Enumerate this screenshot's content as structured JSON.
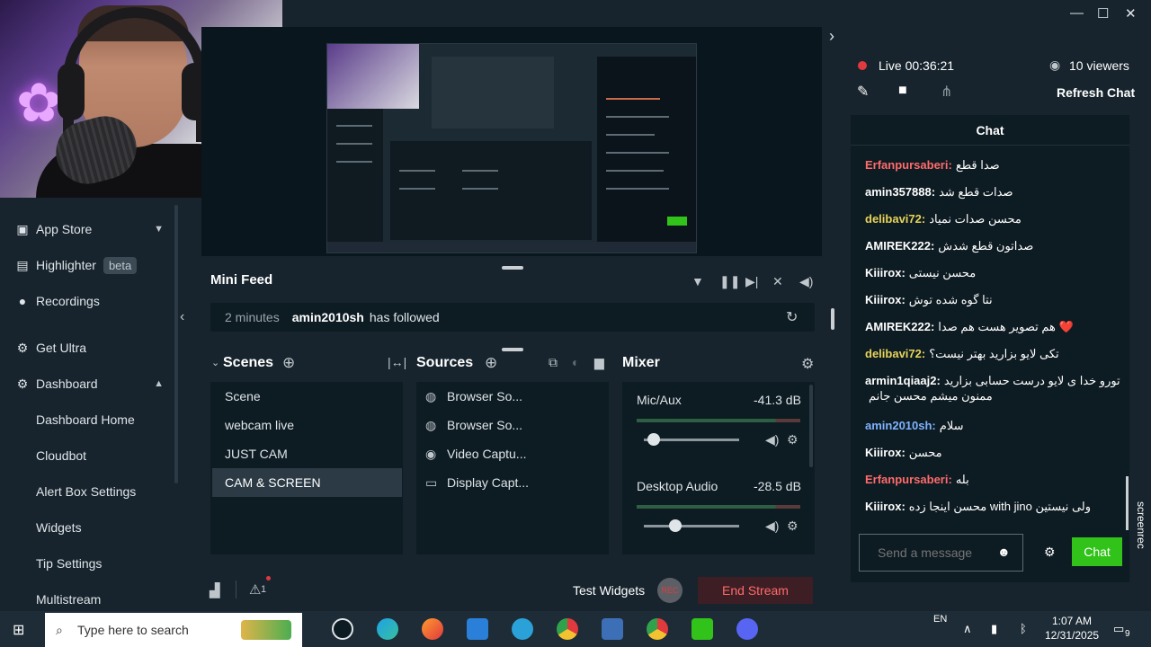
{
  "colors": {
    "live": "#e0393e",
    "chat_send": "#31c31a",
    "end_stream_bg": "#3d1e24",
    "end_stream_text": "#ff6b6b",
    "bg": "#17242d",
    "panel": "#0d1b22"
  },
  "window_controls": {
    "minimize": "—",
    "maximize": "☐",
    "close": "✕"
  },
  "sidebar": {
    "items": [
      {
        "label": "App Store",
        "icon": "app-store-icon"
      },
      {
        "label": "Highlighter",
        "badge": "beta",
        "icon": "highlighter-icon"
      },
      {
        "label": "Recordings",
        "icon": "recordings-icon"
      },
      {
        "label": "Get Ultra",
        "icon": "ultra-icon"
      },
      {
        "label": "Dashboard",
        "icon": "dashboard-icon"
      },
      {
        "label": "Dashboard Home"
      },
      {
        "label": "Cloudbot"
      },
      {
        "label": "Alert Box Settings"
      },
      {
        "label": "Widgets"
      },
      {
        "label": "Tip Settings"
      },
      {
        "label": "Multistream"
      }
    ]
  },
  "mini_feed": {
    "title": "Mini Feed",
    "event": {
      "time": "2 minutes",
      "user": "amin2010sh",
      "action": "has followed"
    }
  },
  "scenes": {
    "title": "Scenes",
    "items": [
      "Scene",
      "webcam live",
      "JUST CAM",
      "CAM & SCREEN"
    ],
    "active": "CAM & SCREEN"
  },
  "sources": {
    "title": "Sources",
    "items": [
      {
        "label": "Browser So...",
        "icon": "globe-icon"
      },
      {
        "label": "Browser So...",
        "icon": "globe-icon"
      },
      {
        "label": "Video Captu...",
        "icon": "camera-icon"
      },
      {
        "label": "Display Capt...",
        "icon": "monitor-icon"
      }
    ]
  },
  "mixer": {
    "title": "Mixer",
    "channels": [
      {
        "name": "Mic/Aux",
        "db": "-41.3 dB",
        "level": 0.1
      },
      {
        "name": "Desktop Audio",
        "db": "-28.5 dB",
        "level": 0.33
      }
    ]
  },
  "bottom_bar": {
    "test_widgets": "Test Widgets",
    "rec": "REC",
    "end_stream": "End Stream",
    "alert_count": "1"
  },
  "stream": {
    "live": "Live 00:36:21",
    "viewers": "10 viewers",
    "refresh_chat": "Refresh Chat"
  },
  "chat": {
    "title": "Chat",
    "messages": [
      {
        "user": "Erfanpursaberi:",
        "text": "صدا قطع",
        "color": "#ff6b6b"
      },
      {
        "user": "amin357888:",
        "text": "صدات قطع شد",
        "color": "#ffffff"
      },
      {
        "user": "delibavi72:",
        "text": "محسن صدات نمیاد",
        "color": "#e8d35a"
      },
      {
        "user": "AMIREK222:",
        "text": "صداتون قطع شدش",
        "color": "#ffffff"
      },
      {
        "user": "Kiiirox:",
        "text": "محسن نیستی",
        "color": "#ffffff"
      },
      {
        "user": "Kiiirox:",
        "text": "نتا گوه شده توش",
        "color": "#ffffff"
      },
      {
        "user": "AMIREK222:",
        "text": "هم تصویر هست هم صدا ❤️",
        "color": "#ffffff"
      },
      {
        "user": "delibavi72:",
        "text": "تکی لایو بزارید بهتر نیست؟",
        "color": "#e8d35a"
      },
      {
        "user": "armin1qiaaj2:",
        "text": "تورو خدا ی لایو درست حسابی بزارید",
        "color": "#ffffff"
      },
      {
        "user": "",
        "text": "ممنون میشم محسن جانم",
        "color": "#ffffff"
      },
      {
        "user": "amin2010sh:",
        "text": "سلام",
        "color": "#7fb3ff"
      },
      {
        "user": "Kiiirox:",
        "text": "محسن",
        "color": "#ffffff"
      },
      {
        "user": "Erfanpursaberi:",
        "text": "بله",
        "color": "#ff6b6b"
      },
      {
        "user": "Kiiirox:",
        "text": "محسن اینجا زده with jino ولی نیستین",
        "color": "#ffffff"
      }
    ],
    "input_placeholder": "Send a message",
    "send_label": "Chat"
  },
  "watermark": "screenrec",
  "taskbar": {
    "search_placeholder": "Type here to search",
    "language": "EN",
    "time": "1:07 AM",
    "date": "12/31/2025",
    "notification_count": "9"
  }
}
